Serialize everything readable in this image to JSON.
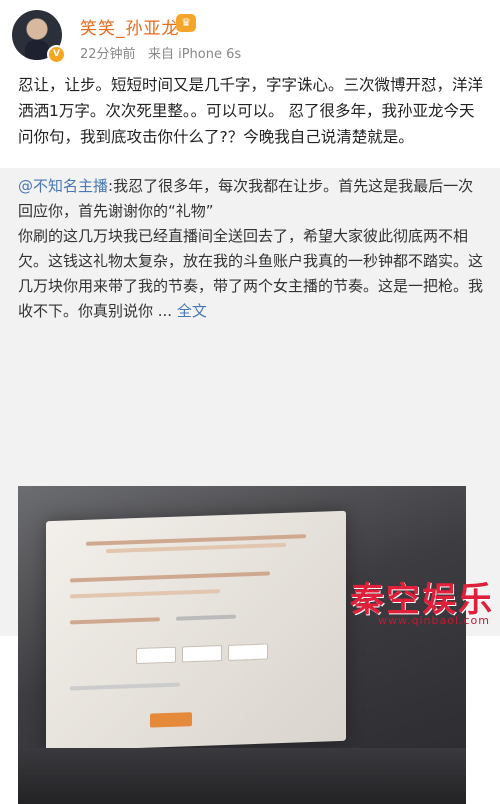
{
  "user": {
    "name": "笑笑_孙亚龙",
    "time": "22分钟前",
    "source": "来自 iPhone 6s"
  },
  "post_text": "忍让，让步。短短时间又是几千字，字字诛心。三次微博开怼，洋洋洒洒1万字。次次死里整。。可以可以。 忍了很多年，我孙亚龙今天问你句，我到底攻击你什么了?？今晚我自己说清楚就是。",
  "repost": {
    "mention": "@不知名主播",
    "text": ":我忍了很多年，每次我都在让步。首先这是我最后一次回应你，首先谢谢你的“礼物”\n你刷的这几万块我已经直播间全送回去了，希望大家彼此彻底两不相欠。这钱这礼物太复杂，放在我的斗鱼账户我真的一秒钟都不踏实。这几万块你用来带了我的节奏，带了两个女主播的节奏。这是一把枪。我收不下。你真别说你 ...",
    "full_text_link": "全文"
  },
  "watermark": {
    "brand": "秦空娱乐",
    "url": "www.qinbaol.com"
  },
  "colors": {
    "username": "#e86b1c",
    "link": "#4a77b5",
    "repost_bg": "#f2f2f2",
    "watermark": "#e0203a"
  }
}
